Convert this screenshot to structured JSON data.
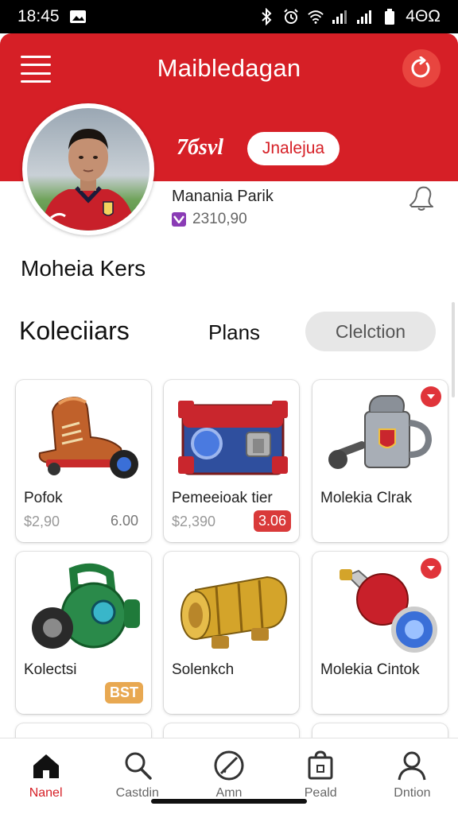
{
  "status_bar": {
    "time": "18:45",
    "battery": "4ΘΩ",
    "icons": [
      "gallery-icon",
      "bluetooth-icon",
      "alarm-icon",
      "wifi-icon",
      "signal-icon",
      "signal-icon",
      "battery-icon"
    ]
  },
  "header": {
    "title": "Maibledagan",
    "level_text": "7бsvl",
    "pill_label": "Jnalejua",
    "accent_color": "#d61f26"
  },
  "profile": {
    "player_name": "Manania Parik",
    "coins": "2310,90",
    "section_name": "Moheia Kers"
  },
  "tabs": {
    "left": "Koleciiars",
    "middle": "Plans",
    "right": "Clelction"
  },
  "items": [
    {
      "name": "Pofok",
      "price": "$2,90",
      "tag": "6.00",
      "tag_style": "plain",
      "badge": false,
      "icon": "boot-skate-icon"
    },
    {
      "name": "Pemeeioak tier",
      "price": "$2,390",
      "tag": "3.06",
      "tag_style": "red",
      "badge": false,
      "icon": "chest-icon"
    },
    {
      "name": "Molekia Clrak",
      "price": "",
      "tag": "",
      "tag_style": "",
      "badge": true,
      "icon": "mug-icon"
    },
    {
      "name": "Kolectsi",
      "price": "",
      "tag": "BST",
      "tag_style": "gold",
      "badge": false,
      "icon": "kettlebell-icon"
    },
    {
      "name": "Solenkch",
      "price": "",
      "tag": "",
      "tag_style": "",
      "badge": false,
      "icon": "golden-cylinder-icon"
    },
    {
      "name": "Molekia Cintok",
      "price": "",
      "tag": "",
      "tag_style": "",
      "badge": true,
      "icon": "rocket-icon"
    }
  ],
  "bottom_nav": [
    {
      "label": "Nanel",
      "icon": "home-icon",
      "active": true
    },
    {
      "label": "Castdin",
      "icon": "search-icon",
      "active": false
    },
    {
      "label": "Amn",
      "icon": "compass-icon",
      "active": false
    },
    {
      "label": "Peald",
      "icon": "bag-icon",
      "active": false
    },
    {
      "label": "Dntion",
      "icon": "profile-icon",
      "active": false
    }
  ]
}
